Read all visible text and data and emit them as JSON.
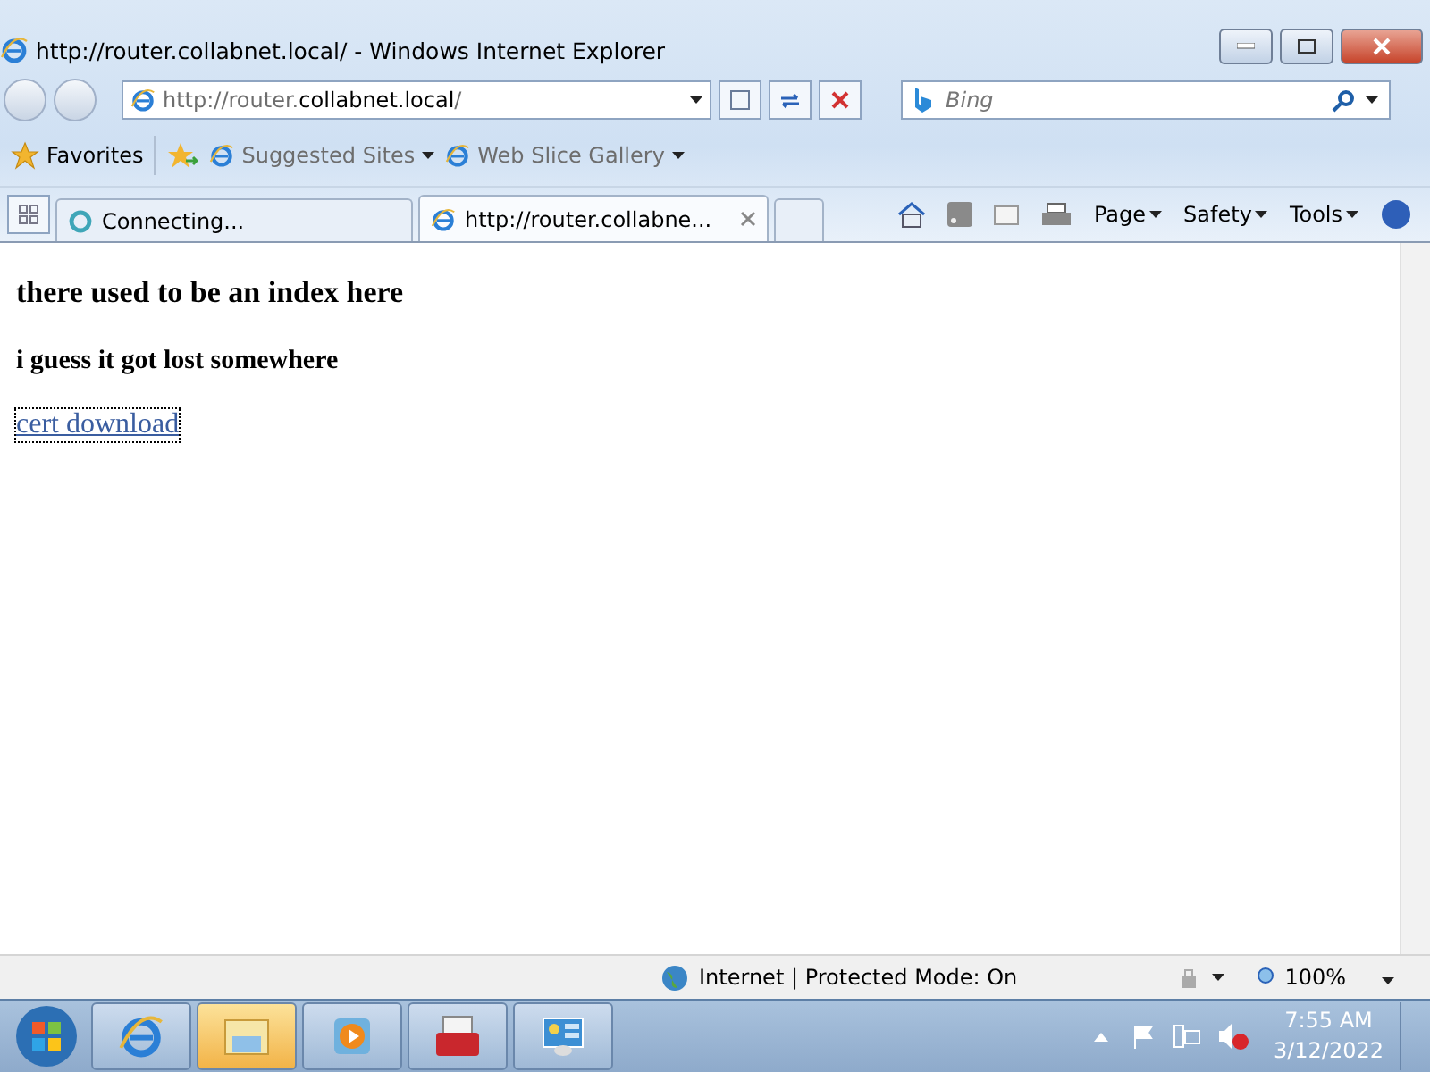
{
  "window": {
    "title": "http://router.collabnet.local/ - Windows Internet Explorer"
  },
  "address": {
    "prefix": "http://router.",
    "host": "collabnet.local",
    "suffix": "/"
  },
  "search": {
    "placeholder": "Bing"
  },
  "favorites_bar": {
    "favorites": "Favorites",
    "items": [
      "Suggested Sites",
      "Web Slice Gallery"
    ]
  },
  "tabs": [
    {
      "label": "Connecting...",
      "selected": false,
      "loading": true
    },
    {
      "label": "http://router.collabne...",
      "selected": true,
      "loading": false
    }
  ],
  "command_bar": [
    "Page",
    "Safety",
    "Tools"
  ],
  "page": {
    "heading": "there used to be an index here",
    "subheading": "i guess it got lost somewhere",
    "link": "cert download"
  },
  "status_bar": {
    "zone": "Internet | Protected Mode: On",
    "zoom": "100%"
  },
  "taskbar": {
    "buttons": [
      {
        "kind": "ie",
        "selected": false
      },
      {
        "kind": "explorer",
        "selected": true
      },
      {
        "kind": "media",
        "selected": false
      },
      {
        "kind": "toolbox",
        "selected": false
      },
      {
        "kind": "panel",
        "selected": false
      }
    ],
    "time": "7:55 AM",
    "date": "3/12/2022"
  }
}
